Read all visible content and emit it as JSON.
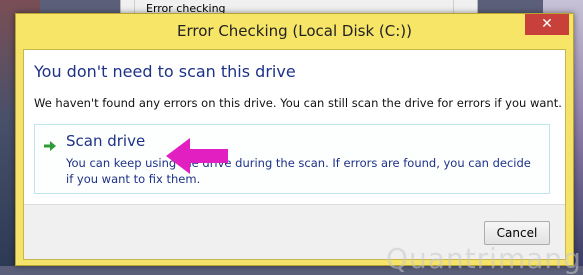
{
  "background": {
    "group_label": "Error checking"
  },
  "dialog": {
    "title": "Error Checking (Local Disk (C:))",
    "close_glyph": "✕",
    "heading": "You don't need to scan this drive",
    "description": "We haven't found any errors on this drive. You can still scan the drive for errors if you want.",
    "command": {
      "icon": "green-arrow-right-icon",
      "title": "Scan drive",
      "description": "You can keep using the drive during the scan. If errors are found, you can decide if you want to fix them."
    },
    "cancel_label": "Cancel"
  },
  "watermark": "Quantrimang",
  "colors": {
    "title_bar": "#f7e567",
    "heading_blue": "#1e3287",
    "close_red": "#c7403a",
    "annotation_magenta": "#e21fc0",
    "arrow_green": "#2e9c36"
  }
}
